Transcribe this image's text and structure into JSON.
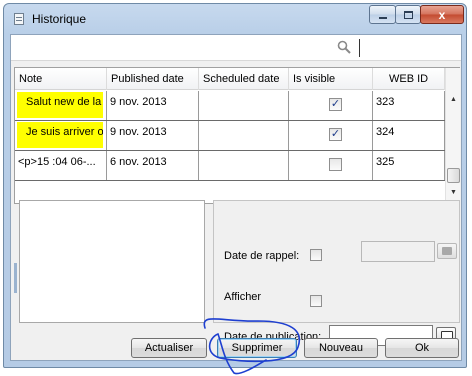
{
  "window": {
    "title": "Historique",
    "icon": "notepad-icon",
    "controls": {
      "minimize": "minimize-icon",
      "maximize": "maximize-icon",
      "close_label": "x"
    }
  },
  "search": {
    "icon": "search-icon",
    "value": ""
  },
  "grid": {
    "columns": [
      "Note",
      "Published date",
      "Scheduled date",
      "Is visible",
      "WEB ID"
    ],
    "rows": [
      {
        "note": "Salut new de la machine",
        "published": "9 nov. 2013",
        "scheduled": "",
        "visible": true,
        "web_id": "323",
        "highlight": true
      },
      {
        "note": "Je suis arriver ok",
        "published": "9 nov. 2013",
        "scheduled": "",
        "visible": true,
        "web_id": "324",
        "highlight": true
      },
      {
        "note": "<p>15 :04 06-...",
        "published": "6 nov. 2013",
        "scheduled": "",
        "visible": false,
        "web_id": "325",
        "highlight": false
      }
    ],
    "highlight_color": "#ffff00",
    "checkmark": "✓"
  },
  "details": {
    "date_rappel_label": "Date de rappel:",
    "date_rappel_checked": false,
    "date_rappel_value": "",
    "afficher_label": "Afficher",
    "afficher_checked": false,
    "date_publication_label": "Date de publication:",
    "date_publication_value": ""
  },
  "buttons": {
    "actualiser": "Actualiser",
    "supprimer": "Supprimer",
    "nouveau": "Nouveau",
    "ok": "Ok"
  },
  "annotation": {
    "color": "#1e3fd0",
    "shape": "hand-drawn circle around Supprimer"
  }
}
